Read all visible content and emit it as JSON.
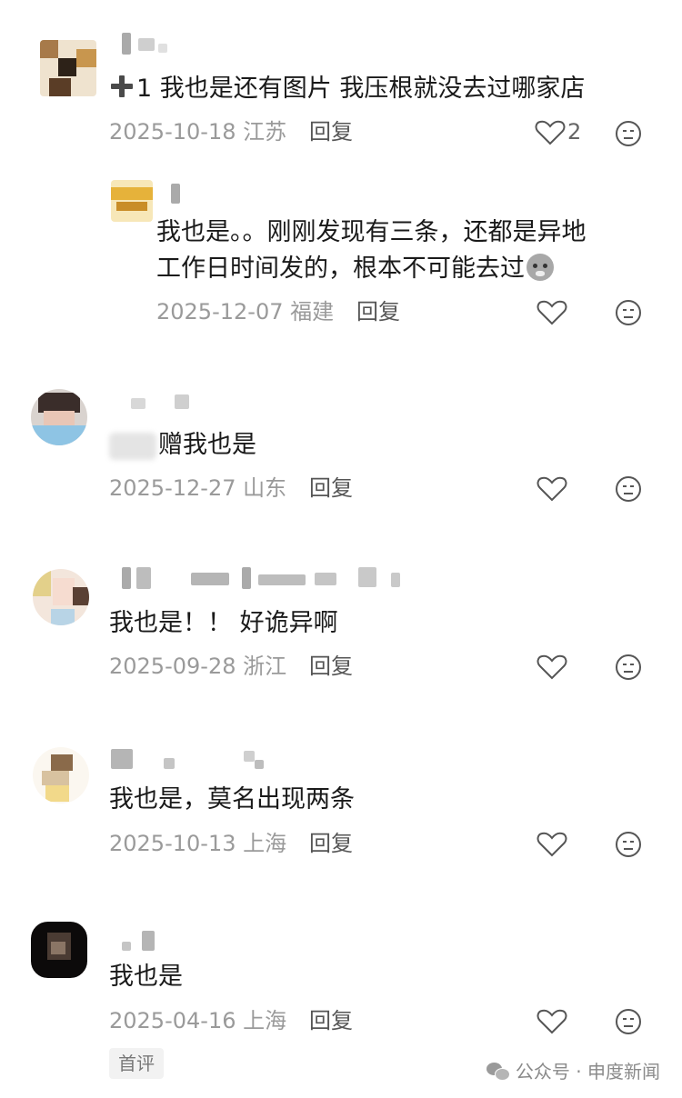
{
  "comments": [
    {
      "text_prefix_icon": "plus-one-icon",
      "text": "1 我也是还有图片 我压根就没去过哪家店",
      "date": "2025-10-18",
      "location": "江苏",
      "reply_label": "回复",
      "likes": "2"
    },
    {
      "text_line1": "我也是。。刚刚发现有三条，还都是异地",
      "text_line2": "工作日时间发的，根本不可能去过",
      "emoji": "cold-sweat-face-emoji",
      "date": "2025-12-07",
      "location": "福建",
      "reply_label": "回复"
    },
    {
      "text": "赠我也是",
      "date": "2025-12-27",
      "location": "山东",
      "reply_label": "回复"
    },
    {
      "text": "我也是！！ 好诡异啊",
      "date": "2025-09-28",
      "location": "浙江",
      "reply_label": "回复"
    },
    {
      "text": "我也是，莫名出现两条",
      "date": "2025-10-13",
      "location": "上海",
      "reply_label": "回复"
    },
    {
      "text": "我也是",
      "date": "2025-04-16",
      "location": "上海",
      "reply_label": "回复",
      "badge": "首评"
    }
  ],
  "watermark": "公众号 · 申度新闻",
  "icons": {
    "like": "heart-outline-icon",
    "react": "neutral-face-icon",
    "watermark": "wechat-icon"
  }
}
